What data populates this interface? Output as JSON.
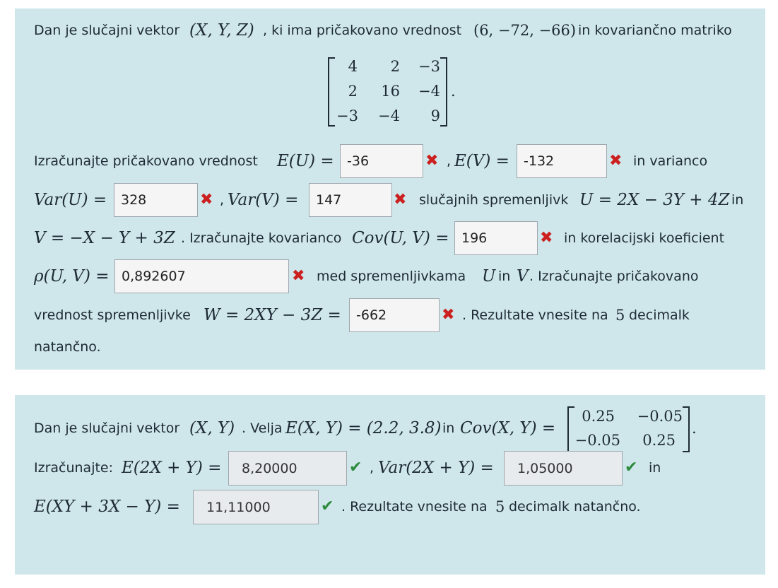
{
  "q1": {
    "intro": "Dan je slučajni vektor",
    "vec": "(X, Y, Z)",
    "intro2": ", ki ima pričakovano vrednost",
    "mean": "(6, −72, −66)",
    "intro3": "in kovariančno matriko",
    "matrix": [
      [
        "4",
        "2",
        "−3"
      ],
      [
        "2",
        "16",
        "−4"
      ],
      [
        "−3",
        "−4",
        "9"
      ]
    ],
    "matrix_end": ".",
    "l2_text": "Izračunajte pričakovano vrednost",
    "EU": "E(U) =",
    "EU_value": "-36",
    "comma1": ",",
    "EV": "E(V) =",
    "EV_value": "-132",
    "in_variance": "in varianco",
    "VarU": "Var(U) =",
    "VarU_value": "328",
    "comma2": ",",
    "VarV": "Var(V) =",
    "VarV_value": "147",
    "rv_text": "slučajnih spremenljivk",
    "U_def": "U = 2X − 3Y + 4Z",
    "in_word": "in",
    "V_def": "V = −X − Y + 3Z",
    "cov_text": ". Izračunajte kovarianco",
    "Cov": "Cov(U, V) =",
    "Cov_value": "196",
    "corr_text": "in korelacijski koeficient",
    "rho": "ρ(U, V) =",
    "rho_value": "0,892607",
    "between_text": "med spremenljivkama",
    "U": "U",
    "in_word2": "in",
    "V": "V",
    "exp_text": ". Izračunajte pričakovano",
    "W_text": "vrednost spremenljivke",
    "W_def": "W = 2XY − 3Z =",
    "W_value": "-662",
    "result_text": ". Rezultate vnesite na",
    "five": "5",
    "decimal_text": "decimalk",
    "natancno": "natančno."
  },
  "q2": {
    "intro": "Dan je slučajni vektor",
    "vec": "(X, Y)",
    "velja": ". Velja",
    "E_def": "E(X, Y) = (2.2, 3.8)",
    "in_word": "in",
    "Cov_def": "Cov(X, Y) =",
    "matrix": [
      [
        "0.25",
        "−0.05"
      ],
      [
        "−0.05",
        "0.25"
      ]
    ],
    "matrix_end": ".",
    "izr": "Izračunajte:",
    "E2": "E(2X + Y) =",
    "E2_value": "8,20000",
    "comma": ",",
    "Var2": "Var(2X + Y) =",
    "Var2_value": "1,05000",
    "in_word2": "in",
    "E3": "E(XY + 3X − Y) =",
    "E3_value": "11,11000",
    "result_text": ". Rezultate vnesite na",
    "five": "5",
    "tail": "decimalk natančno."
  },
  "icons": {
    "wrong": "cross-icon",
    "correct": "check-icon"
  },
  "colors": {
    "card": "#cfe7ea",
    "wrong": "#cc1f1f",
    "correct": "#2e8a3d"
  }
}
